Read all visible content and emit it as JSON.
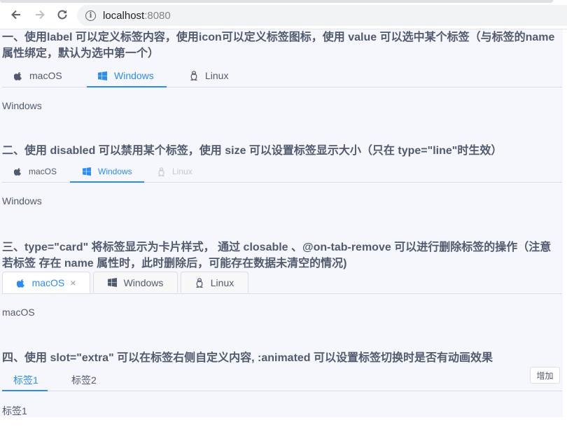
{
  "browser": {
    "url_host": "localhost",
    "url_port": ":8080",
    "back_icon": "arrow-left-icon",
    "forward_icon": "arrow-right-icon",
    "reload_icon": "reload-icon",
    "info_icon": "info-icon"
  },
  "section1": {
    "title": "一、使用label 可以定义标签内容，使用icon可以定义标签图标，使用 value 可以选中某个标签（与标签的name属性绑定，默认为选中第一个）",
    "tabs": [
      {
        "label": "macOS",
        "icon": "apple-icon"
      },
      {
        "label": "Windows",
        "icon": "windows-icon"
      },
      {
        "label": "Linux",
        "icon": "linux-icon"
      }
    ],
    "active": "Windows",
    "content": "Windows"
  },
  "section2": {
    "title": "二、使用 disabled 可以禁用某个标签，使用 size 可以设置标签显示大小（只在 type=\"line\"时生效）",
    "tabs": [
      {
        "label": "macOS",
        "icon": "apple-icon"
      },
      {
        "label": "Windows",
        "icon": "windows-icon"
      },
      {
        "label": "Linux",
        "icon": "linux-icon",
        "disabled": true
      }
    ],
    "active": "Windows",
    "content": "Windows"
  },
  "section3": {
    "title": "三、type=\"card\" 将标签显示为卡片样式， 通过 closable 、@on-tab-remove 可以进行删除标签的操作（注意若标签 存在 name 属性时，此时删除后，可能存在数据未清空的情况)",
    "tabs": [
      {
        "label": "macOS",
        "icon": "apple-icon",
        "closable": true
      },
      {
        "label": "Windows",
        "icon": "windows-icon"
      },
      {
        "label": "Linux",
        "icon": "linux-icon"
      }
    ],
    "active": "macOS",
    "close_glyph": "×",
    "content": "macOS"
  },
  "section4": {
    "title": "四、使用 slot=\"extra\" 可以在标签右侧自定义内容, :animated 可以设置标签切换时是否有动画效果",
    "tabs": [
      {
        "label": "标签1"
      },
      {
        "label": "标签2"
      }
    ],
    "active": "标签1",
    "extra_button": "增加",
    "content": "标签1"
  },
  "colors": {
    "accent": "#2d8cf0",
    "text": "#515a6e",
    "disabled": "#c5c8ce",
    "page_bg": "#f5f7fd",
    "border": "#dcdee2"
  }
}
